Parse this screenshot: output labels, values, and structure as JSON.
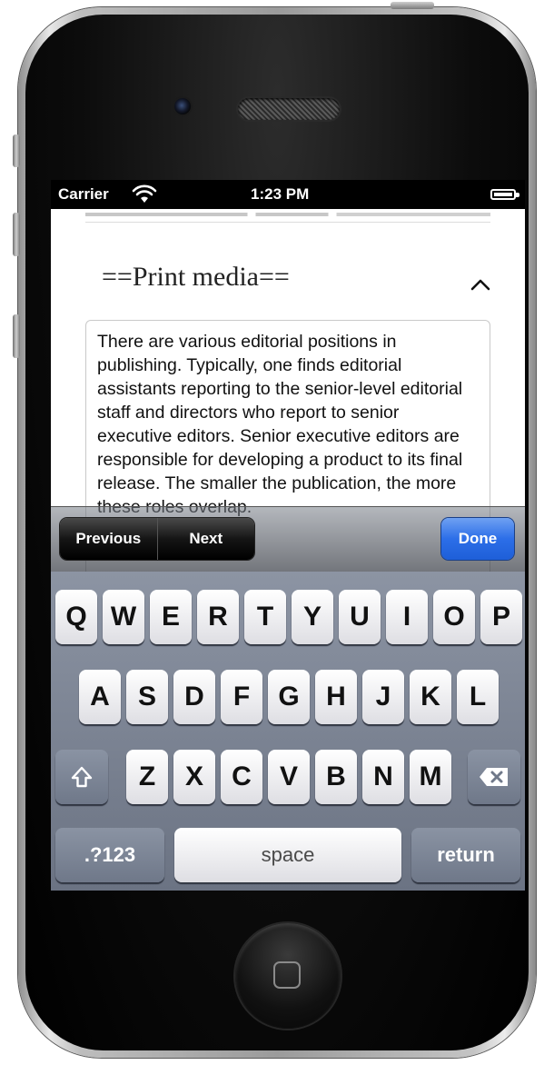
{
  "statusbar": {
    "carrier": "Carrier",
    "time": "1:23 PM"
  },
  "section": {
    "heading": "==Print media=="
  },
  "editor": {
    "text": "There are various editorial positions in publishing. Typically, one finds editorial assistants reporting to the senior-level editorial staff and directors who report to senior executive editors. Senior executive editors are responsible for developing a product to its final release. The smaller the publication, the more these roles overlap."
  },
  "toolbar": {
    "previous": "Previous",
    "next": "Next",
    "done": "Done"
  },
  "keyboard": {
    "row1": [
      "Q",
      "W",
      "E",
      "R",
      "T",
      "Y",
      "U",
      "I",
      "O",
      "P"
    ],
    "row2": [
      "A",
      "S",
      "D",
      "F",
      "G",
      "H",
      "J",
      "K",
      "L"
    ],
    "row3": [
      "Z",
      "X",
      "C",
      "V",
      "B",
      "N",
      "M"
    ],
    "numbers": ".?123",
    "space": "space",
    "return": "return"
  }
}
